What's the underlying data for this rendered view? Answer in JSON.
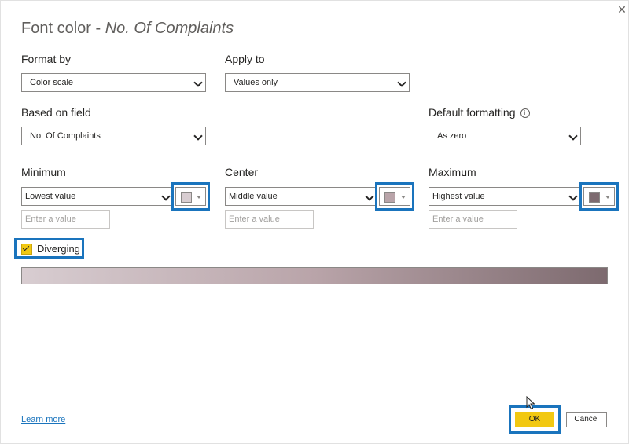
{
  "dialog": {
    "title_prefix": "Font color - ",
    "title_field": "No. Of Complaints",
    "close_glyph": "✕"
  },
  "format_by": {
    "label": "Format by",
    "value": "Color scale"
  },
  "apply_to": {
    "label": "Apply to",
    "value": "Values only"
  },
  "based_on_field": {
    "label": "Based on field",
    "value": "No. Of Complaints"
  },
  "default_formatting": {
    "label": "Default formatting",
    "info_glyph": "i",
    "value": "As zero"
  },
  "minimum": {
    "label": "Minimum",
    "value": "Lowest value",
    "placeholder": "Enter a value",
    "color": "#d8cdd1"
  },
  "center": {
    "label": "Center",
    "value": "Middle value",
    "placeholder": "Enter a value",
    "color": "#b9a4a9"
  },
  "maximum": {
    "label": "Maximum",
    "value": "Highest value",
    "placeholder": "Enter a value",
    "color": "#7d6a6f"
  },
  "diverging": {
    "label": "Diverging",
    "checked": true
  },
  "gradient": {
    "colors": [
      "#d8cdd1",
      "#b9a4a9",
      "#7d6a6f"
    ]
  },
  "footer": {
    "learn_more": "Learn more",
    "ok": "OK",
    "cancel": "Cancel"
  },
  "colors": {
    "accent": "#f2c811",
    "highlight": "#1a74bd",
    "link": "#1a74bd"
  }
}
